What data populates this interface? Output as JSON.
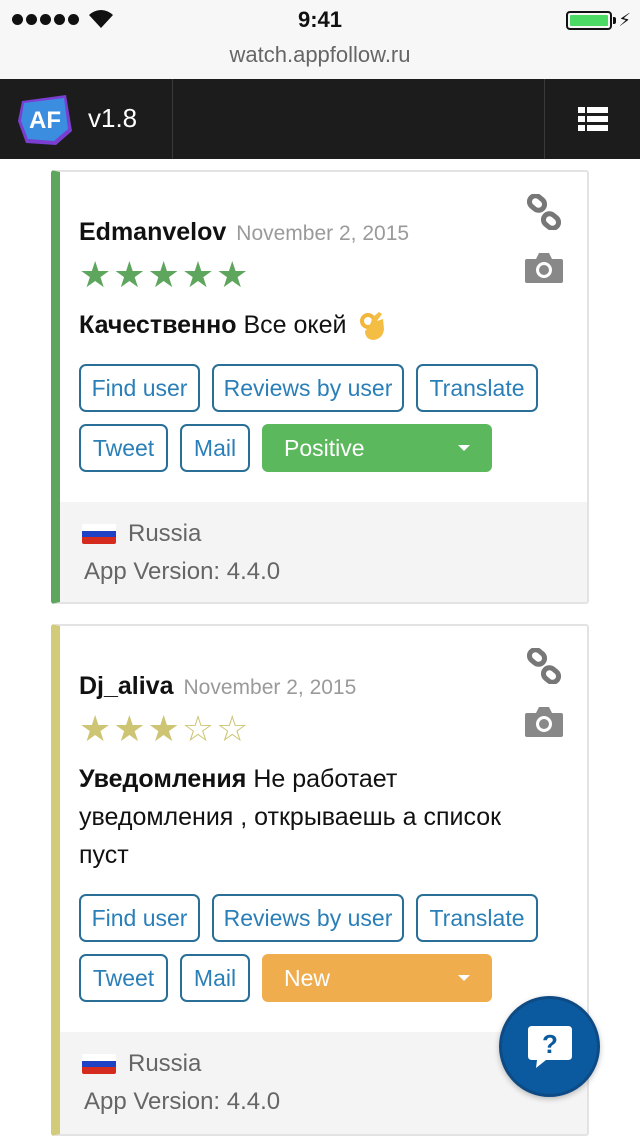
{
  "status_bar": {
    "time": "9:41"
  },
  "browser": {
    "url": "watch.appfollow.ru"
  },
  "navbar": {
    "logo_text": "AF",
    "version": "v1.8",
    "menu_icon": "list-menu-icon"
  },
  "reviews": [
    {
      "author": "Edmanvelov",
      "date": "November 2, 2015",
      "rating": 5,
      "stars_text": "★★★★★",
      "title": "Качественно",
      "body": "Все окей",
      "emoji": "ok-hand-icon",
      "buttons": {
        "find_user": "Find user",
        "reviews_by_user": "Reviews by user",
        "translate": "Translate",
        "tweet": "Tweet",
        "mail": "Mail"
      },
      "status": "Positive",
      "status_color": "#5cb85c",
      "accent_color": "#5ea55d",
      "country": "Russia",
      "app_version": "App Version: 4.4.0"
    },
    {
      "author": "Dj_aliva",
      "date": "November 2, 2015",
      "rating": 3,
      "stars_text": "★★★☆☆",
      "title": "Уведомления",
      "body": "Не работает уведомления , открываешь а список пуст",
      "buttons": {
        "find_user": "Find user",
        "reviews_by_user": "Reviews by user",
        "translate": "Translate",
        "tweet": "Tweet",
        "mail": "Mail"
      },
      "status": "New",
      "status_color": "#f0ad4e",
      "accent_color": "#d2cc7a",
      "country": "Russia",
      "app_version": "App Version: 4.4.0"
    }
  ],
  "help": {
    "label": "?"
  }
}
